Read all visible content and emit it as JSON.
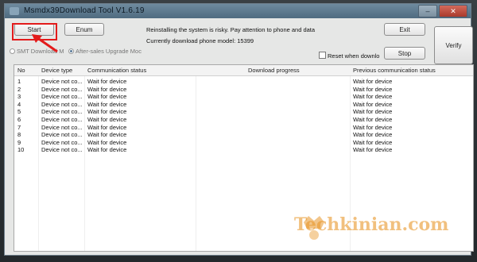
{
  "window": {
    "title": "Msmdx39Download Tool V1.6.19",
    "win_minimize": "–",
    "win_close": "✕"
  },
  "toolbar": {
    "start_label": "Start",
    "enum_label": "Enum",
    "exit_label": "Exit",
    "stop_label": "Stop",
    "verify_label": "Verify"
  },
  "info": {
    "warning": "Reinstalling the system is risky. Pay attention to phone and data",
    "model_line": "Currently download phone model: 15399"
  },
  "options": {
    "radio_smt": "SMT Download M",
    "radio_after_sales": "After-sales Upgrade Moc",
    "reset_checkbox": "Reset when downlo"
  },
  "table": {
    "headers": [
      "No",
      "Device type",
      "Communication status",
      "Download progress",
      "Previous communication status"
    ],
    "rows": [
      {
        "no": "1",
        "device": "Device not co...",
        "comm": "Wait for device",
        "prev": "Wait for device"
      },
      {
        "no": "2",
        "device": "Device not co...",
        "comm": "Wait for device",
        "prev": "Wait for device"
      },
      {
        "no": "3",
        "device": "Device not co...",
        "comm": "Wait for device",
        "prev": "Wait for device"
      },
      {
        "no": "4",
        "device": "Device not co...",
        "comm": "Wait for device",
        "prev": "Wait for device"
      },
      {
        "no": "5",
        "device": "Device not co...",
        "comm": "Wait for device",
        "prev": "Wait for device"
      },
      {
        "no": "6",
        "device": "Device not co...",
        "comm": "Wait for device",
        "prev": "Wait for device"
      },
      {
        "no": "7",
        "device": "Device not co...",
        "comm": "Wait for device",
        "prev": "Wait for device"
      },
      {
        "no": "8",
        "device": "Device not co...",
        "comm": "Wait for device",
        "prev": "Wait for device"
      },
      {
        "no": "9",
        "device": "Device not co...",
        "comm": "Wait for device",
        "prev": "Wait for device"
      },
      {
        "no": "10",
        "device": "Device not co...",
        "comm": "Wait for device",
        "prev": "Wait for device"
      }
    ]
  },
  "annotation": {
    "color": "#e31b1b"
  },
  "watermark": {
    "text": "Techkinian.com",
    "color": "#e89628"
  }
}
